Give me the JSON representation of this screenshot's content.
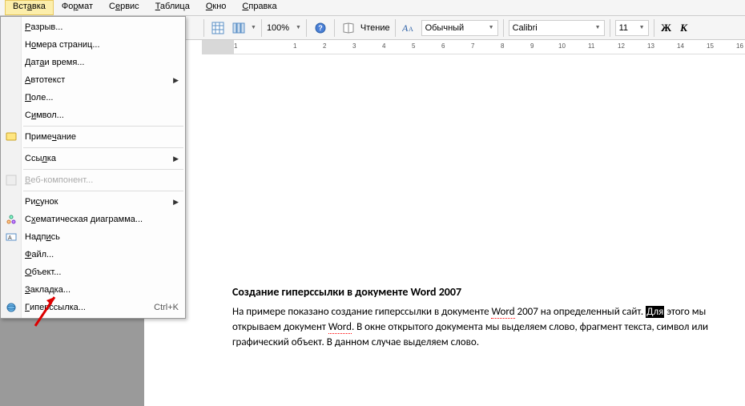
{
  "menubar": {
    "items": [
      {
        "label": "Вст<u>а</u>вка",
        "active": true
      },
      {
        "label": "Фо<u>р</u>мат"
      },
      {
        "label": "С<u>е</u>рвис"
      },
      {
        "label": "<u>Т</u>аблица"
      },
      {
        "label": "<u>О</u>кно"
      },
      {
        "label": "<u>С</u>правка"
      }
    ]
  },
  "toolbar": {
    "zoom": "100%",
    "reading_label": "Чтение",
    "style": "Обычный",
    "font": "Calibri",
    "size": "11"
  },
  "ruler": {
    "marks": [
      "1",
      "",
      "1",
      "2",
      "3",
      "4",
      "5",
      "6",
      "7",
      "8",
      "9",
      "10",
      "11",
      "12",
      "13",
      "14",
      "15",
      "16"
    ]
  },
  "menu": {
    "items": [
      {
        "label": "<u>Р</u>азрыв..."
      },
      {
        "label": "Н<u>о</u>мера страниц..."
      },
      {
        "label": "Дат<u>а</u> и время..."
      },
      {
        "label": "<u>А</u>втотекст",
        "submenu": true
      },
      {
        "label": "<u>П</u>оле..."
      },
      {
        "label": "С<u>и</u>мвол..."
      },
      {
        "sep": true
      },
      {
        "label": "Приме<u>ч</u>ание",
        "icon": "note"
      },
      {
        "sep": true
      },
      {
        "label": "Ссы<u>л</u>ка",
        "submenu": true
      },
      {
        "sep": true
      },
      {
        "label": "<u>В</u>еб-компонент...",
        "disabled": true,
        "icon": "web"
      },
      {
        "sep": true
      },
      {
        "label": "Ри<u>с</u>унок",
        "submenu": true
      },
      {
        "label": "С<u>х</u>ематическая диаграмма...",
        "icon": "diagram"
      },
      {
        "label": "Надп<u>и</u>сь",
        "icon": "textbox"
      },
      {
        "label": "<u>Ф</u>айл..."
      },
      {
        "label": "<u>О</u>бъект..."
      },
      {
        "label": "<u>З</u>акладка..."
      },
      {
        "label": "<u>Г</u>иперссылка...",
        "shortcut": "Ctrl+K",
        "icon": "hyperlink"
      }
    ]
  },
  "doc": {
    "title": "Создание гиперссылки в документе Word 2007",
    "body_parts": {
      "p1a": "На примере показано создание гиперссылки в документе ",
      "word1": "Word",
      "p1b": " 2007 на определенный сайт. ",
      "hl": "Для",
      "p2a": " этого мы открываем документ ",
      "word2": "Word",
      "p2b": ". В окне открытого документа мы выделяем слово, фрагмент текста, символ или графический объект. В данном случае выделяем слово."
    }
  }
}
